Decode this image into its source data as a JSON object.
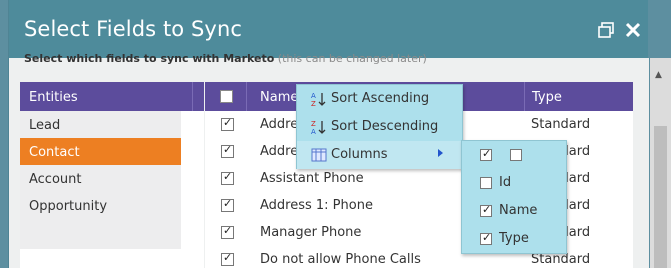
{
  "dialog": {
    "title": "Select Fields to Sync",
    "instructions_bold": "Select which fields to sync with Marketo",
    "instructions_hint": "(this can be changed later)"
  },
  "entities": {
    "header": "Entities",
    "items": [
      {
        "label": "Lead",
        "active": false
      },
      {
        "label": "Contact",
        "active": true
      },
      {
        "label": "Account",
        "active": false
      },
      {
        "label": "Opportunity",
        "active": false
      }
    ]
  },
  "fields": {
    "header_name": "Name",
    "header_type": "Type",
    "rows": [
      {
        "name": "Address",
        "type": "Standard",
        "checked": true
      },
      {
        "name": "Address",
        "type": "Standard",
        "checked": true
      },
      {
        "name": "Assistant Phone",
        "type": "Standard",
        "checked": true
      },
      {
        "name": "Address 1: Phone",
        "type": "Standard",
        "checked": true
      },
      {
        "name": "Manager Phone",
        "type": "Standard",
        "checked": true
      },
      {
        "name": "Do not allow Phone Calls",
        "type": "Standard",
        "checked": true
      }
    ]
  },
  "context_menu": {
    "sort_asc": "Sort Ascending",
    "sort_desc": "Sort Descending",
    "columns": "Columns"
  },
  "columns_submenu": {
    "items": [
      {
        "label": "Id",
        "checked": false
      },
      {
        "label": "Name",
        "checked": true
      },
      {
        "label": "Type",
        "checked": true
      }
    ]
  },
  "colors": {
    "header_bg": "#4e8b9b",
    "grid_header": "#5c4c9c",
    "active_entity": "#ed7f22",
    "menu_bg": "#ade0ec"
  }
}
